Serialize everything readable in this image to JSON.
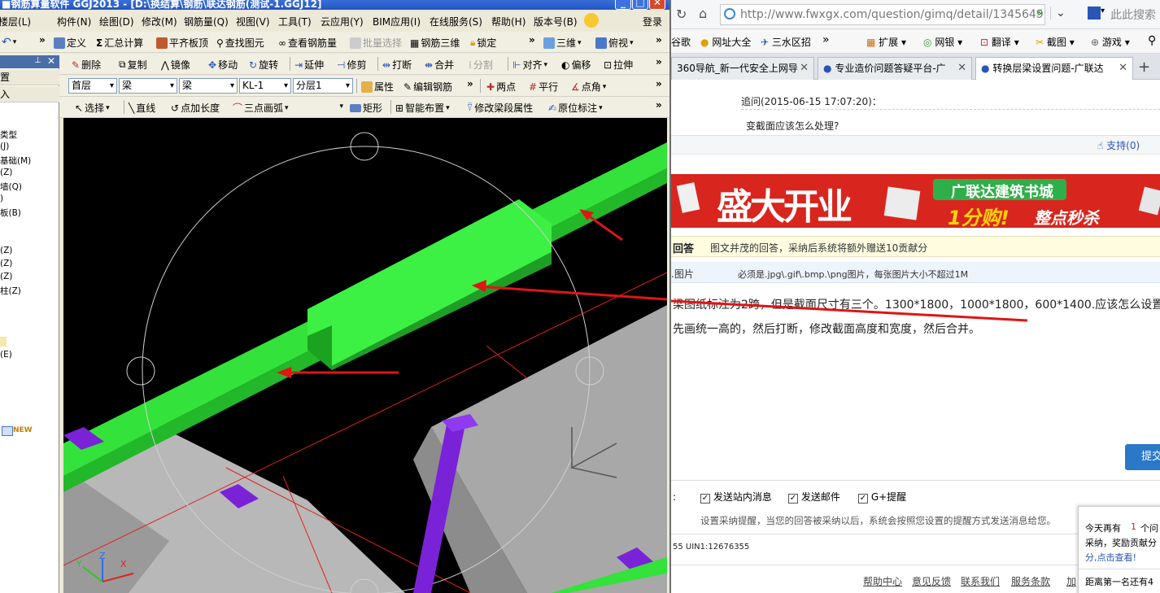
{
  "cad": {
    "title": "■钢筋算量软件 GGJ2013 - [D:\\换结算\\钢筋\\联达钢筋(测试-1.GGJ12]",
    "menu": [
      "楼层(L)",
      "构件(N)",
      "绘图(D)",
      "修改(M)",
      "钢筋量(Q)",
      "视图(V)",
      "工具(T)",
      "云应用(Y)",
      "BIM应用(I)",
      "在线服务(S)",
      "帮助(H)",
      "版本号(B)"
    ],
    "login": "登录",
    "toolbar1": [
      "定义",
      "汇总计算",
      "平齐板顶",
      "查找图元",
      "查看钢筋量",
      "批量选择",
      "钢筋三维",
      "锁定",
      "三维",
      "俯视"
    ],
    "toolbar2": [
      "删除",
      "复制",
      "镜像",
      "移动",
      "旋转",
      "延伸",
      "修剪",
      "打断",
      "合并",
      "分割",
      "对齐",
      "偏移",
      "拉伸"
    ],
    "dropdowns": [
      "首层",
      "梁",
      "梁",
      "KL-1",
      "分层1"
    ],
    "toolbar2b": [
      "属性",
      "编辑钢筋",
      "两点",
      "平行",
      "点角"
    ],
    "toolbar3": [
      "选择",
      "直线",
      "点加长度",
      "三点画弧",
      "矩形",
      "智能布置",
      "修改梁段属性",
      "原位标注"
    ],
    "panel_rows": [
      "置",
      "入"
    ],
    "tree": [
      "类型",
      "(J)",
      "基础(M)",
      "(Z)",
      "墙(Q)",
      ")",
      "板(B)",
      "(Z)",
      "(Z)",
      "(Z)",
      "柱(Z)",
      "(E)"
    ],
    "new_badge": "NEW",
    "axis": {
      "x": "X",
      "y": "Y",
      "z": "Z"
    }
  },
  "browser": {
    "url": "http://www.fwxgx.com/question/gimq/detail/1345649",
    "search_placeholder": "此此搜索",
    "bookmarks": [
      "谷歌",
      "网址大全",
      "三水区招",
      "扩展",
      "网银",
      "翻译",
      "截图",
      "游戏"
    ],
    "tabs": [
      "360导航_新一代安全上网导",
      "专业造价问题答疑平台-广",
      "转换层梁设置问题-广联达"
    ],
    "followup": "追问(2015-06-15 17:07:20)：",
    "followup_text": "变截面应该怎么处理?",
    "support": "支持(0)",
    "ad": {
      "big": "盛大开业",
      "shop": "广联达建筑书城",
      "price": "1分购!",
      "sale": "整点秒杀"
    },
    "answer_head": "回答",
    "answer_note": "图文并茂的回答，采纳后系统将额外赠送10贡献分",
    "img_label": "图片",
    "img_note": "必须是.jpg\\.gif\\.bmp.\\png图片，每张图片大小不超过1M",
    "line1": "梁图纸标注为2跨，但是截面尺寸有三个。1300*1800，1000*1800，600*1400.应该怎么设置",
    "line2": "先画统一高的，然后打断，修改截面高度和宽度，然后合并。",
    "submit": "提交",
    "checks": [
      "发送站内消息",
      "发送邮件",
      "G+提醒"
    ],
    "notice": "设置采纳提醒，当您的回答被采纳以后，系统会按照您设置的提醒方式发送消息给您。",
    "uin": "55 UIN1:12676355",
    "footer": [
      "帮助中心",
      "意见反馈",
      "联系我们",
      "服务条款",
      "加"
    ],
    "popup": [
      "今天再有",
      "1",
      "个问",
      "采纳，奖励贡献分",
      "分,点击查看!",
      "距离第一名还有4"
    ]
  }
}
